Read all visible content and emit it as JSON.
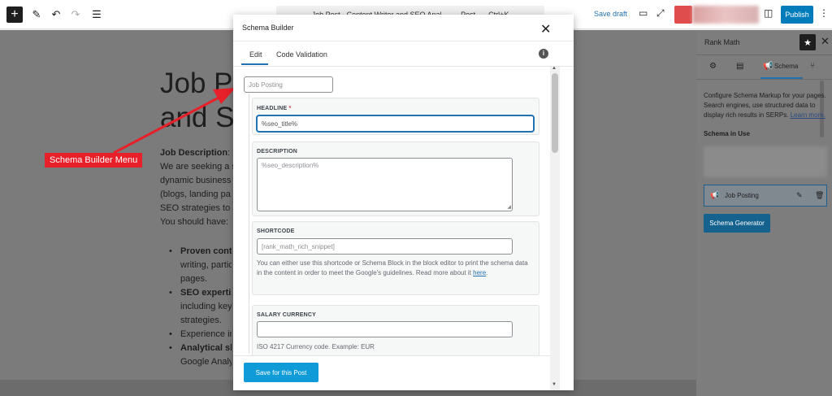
{
  "toolbar": {
    "plus": "+",
    "doc_title": "Job Post - Content Writer and SEO Anal...",
    "doc_type": "Post",
    "shortcut": "Ctrl+K",
    "save_draft": "Save draft",
    "publish": "Publish"
  },
  "post": {
    "title_line1": "Job Po",
    "title_line2": "and S",
    "body": [
      {
        "bold": "Job Description",
        "rest": ":"
      },
      {
        "bold": "",
        "rest": "We are seeking a s"
      },
      {
        "bold": "",
        "rest": "dynamic business"
      },
      {
        "bold": "",
        "rest": "(blogs, landing pa"
      },
      {
        "bold": "",
        "rest": "SEO strategies to"
      },
      {
        "bold": "",
        "rest": "You should have:"
      }
    ],
    "bullets": [
      {
        "bold": "Proven conte",
        "sub": [
          "writing, partic",
          "pages."
        ]
      },
      {
        "bold": "SEO expertis",
        "sub": [
          "including key",
          "strategies."
        ]
      },
      {
        "bold": "",
        "text": "Experience in",
        "sub": []
      },
      {
        "bold": "Analytical sk",
        "sub": [
          "Google Analy"
        ]
      }
    ]
  },
  "annotation": {
    "label": "Schema Builder Menu",
    "color": "#e8202a"
  },
  "modal": {
    "title": "Schema Builder",
    "tabs": {
      "edit": "Edit",
      "code_validation": "Code Validation"
    },
    "schema_name_placeholder": "Job Posting",
    "fields": {
      "headline": {
        "label": "HEADLINE",
        "required": "*",
        "value": "%seo_title%"
      },
      "description": {
        "label": "DESCRIPTION",
        "value": "%seo_description%"
      },
      "shortcode": {
        "label": "SHORTCODE",
        "value": "[rank_math_rich_snippet]",
        "help": "You can either use this shortcode or Schema Block in the block editor to print the schema data in the content in order to meet the Google's guidelines. Read more about it",
        "help_link": "here",
        "help_end": "."
      },
      "salary_currency": {
        "label": "SALARY CURRENCY",
        "value": "",
        "help": "ISO 4217 Currency code. Example: EUR"
      }
    },
    "save_button": "Save for this Post"
  },
  "sidebar": {
    "title": "Rank Math",
    "schema_tab": "Schema",
    "description": "Configure Schema Markup for your pages. Search engines, use structured data to display rich results in SERPs.",
    "learn_more": "Learn more.",
    "schema_in_use": "Schema in Use",
    "job_posting": "Job Posting",
    "generator_button": "Schema Generator"
  }
}
